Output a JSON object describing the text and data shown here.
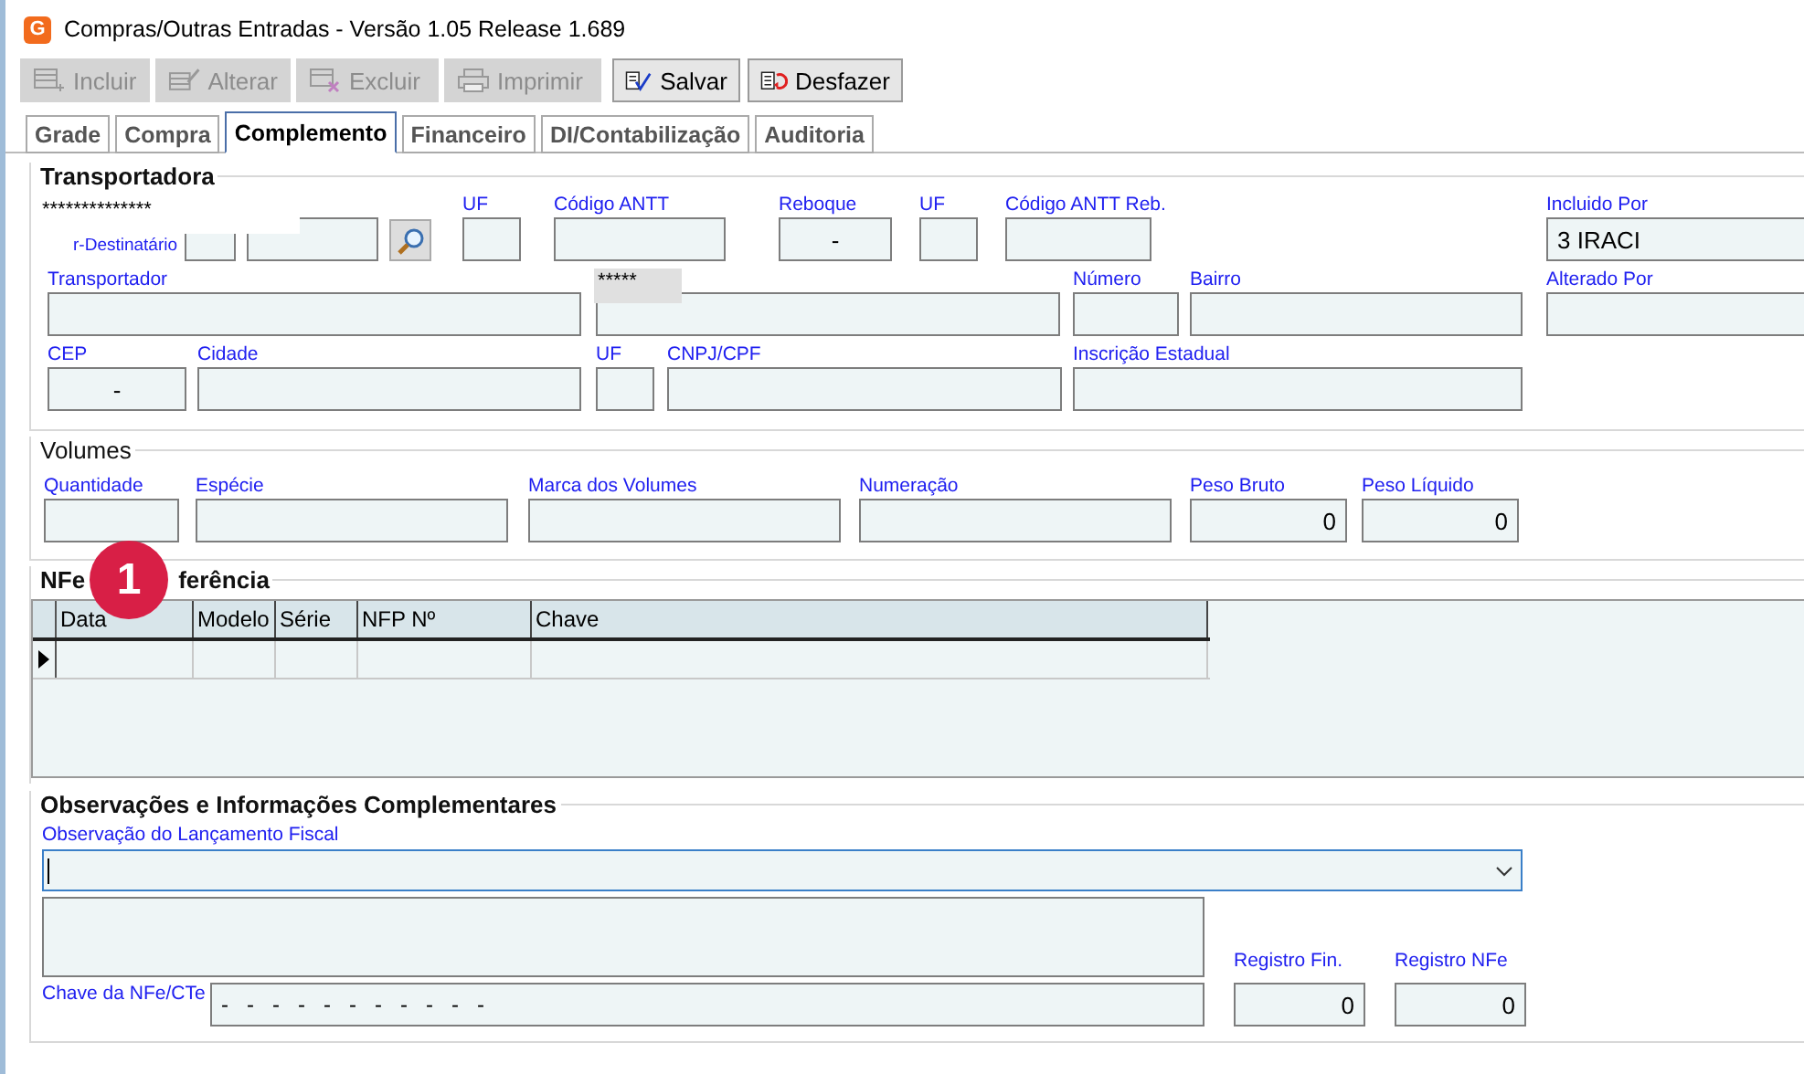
{
  "window": {
    "icon_text": "G",
    "title": "Compras/Outras Entradas - Versão 1.05 Release 1.689"
  },
  "toolbar": [
    {
      "label": "Incluir",
      "disabled": true
    },
    {
      "label": "Alterar",
      "disabled": true
    },
    {
      "label": "Excluir",
      "disabled": true
    },
    {
      "label": "Imprimir",
      "disabled": true
    },
    {
      "label": "Salvar",
      "disabled": false
    },
    {
      "label": "Desfazer",
      "disabled": false
    }
  ],
  "tabs": [
    {
      "label": "Grade",
      "selected": false
    },
    {
      "label": "Compra",
      "selected": false
    },
    {
      "label": "Complemento",
      "selected": true
    },
    {
      "label": "Financeiro",
      "selected": false
    },
    {
      "label": "DI/Contabilização",
      "selected": false
    },
    {
      "label": "Auditoria",
      "selected": false
    }
  ],
  "transportadora": {
    "title": "Transportadora",
    "masked_name": "**************",
    "partial_label": "r-Destinatário",
    "masked_code": "*****",
    "fields": [
      {
        "kind": "field"
      },
      {
        "kind": "field"
      },
      {
        "kind": "search"
      },
      {
        "kind": "field",
        "label": "UF"
      },
      {
        "kind": "field",
        "label": "Código ANTT"
      },
      {
        "kind": "masked",
        "label": "Reboque",
        "value": "-"
      },
      {
        "kind": "field",
        "label": "UF"
      },
      {
        "kind": "field",
        "label": "Código ANTT Reb."
      },
      {
        "kind": "field",
        "label": "Incluido Por",
        "value": "3 IRACI"
      },
      {
        "kind": "field",
        "label": "Transportador"
      },
      {
        "kind": "field"
      },
      {
        "kind": "field",
        "label": "Número"
      },
      {
        "kind": "field",
        "label": "Bairro"
      },
      {
        "kind": "field",
        "label": "Alterado Por"
      },
      {
        "kind": "masked",
        "label": "CEP",
        "value": "-"
      },
      {
        "kind": "field",
        "label": "Cidade"
      },
      {
        "kind": "field",
        "label": "UF"
      },
      {
        "kind": "field",
        "label": "CNPJ/CPF"
      },
      {
        "kind": "field",
        "label": "Inscrição Estadual"
      }
    ]
  },
  "volumes": {
    "title": "Volumes",
    "fields": [
      {
        "kind": "field",
        "label": "Quantidade"
      },
      {
        "kind": "field",
        "label": "Espécie"
      },
      {
        "kind": "field",
        "label": "Marca dos Volumes"
      },
      {
        "kind": "field",
        "label": "Numeração"
      },
      {
        "kind": "number",
        "label": "Peso Bruto",
        "value": "0"
      },
      {
        "kind": "number",
        "label": "Peso Líquido",
        "value": "0"
      }
    ]
  },
  "nfe_referencia": {
    "title_before": "NFe",
    "title_after": "ferência",
    "badge": "1",
    "columns": [
      "Data",
      "Modelo",
      "Série",
      "NFP Nº",
      "Chave"
    ]
  },
  "observacoes": {
    "title": "Observações e Informações Complementares",
    "combo_label": "Observação do Lançamento Fiscal",
    "chave_label": "Chave da NFe/CTe",
    "chave_value": "-   -   -   -   -   -   -   -   -   -   -",
    "registros": [
      {
        "label": "Registro Fin.",
        "value": "0"
      },
      {
        "label": "Registro NFe",
        "value": "0"
      }
    ]
  }
}
